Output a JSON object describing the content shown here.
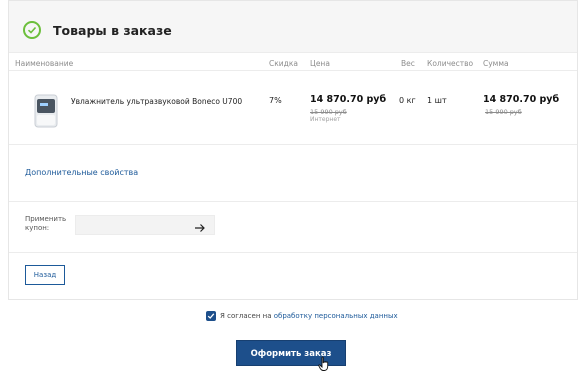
{
  "header": {
    "title": "Товары в заказе"
  },
  "columns": {
    "name": "Наименование",
    "discount": "Скидка",
    "price": "Цена",
    "weight": "Вес",
    "quantity": "Количество",
    "sum": "Сумма"
  },
  "item": {
    "name": "Увлажнитель ультразвуковой Boneco U700",
    "discount": "7%",
    "price": "14 870.70 руб",
    "old_price": "15 990 руб",
    "price_note": "Интернет",
    "weight": "0 кг",
    "quantity": "1 шт",
    "sum": "14 870.70 руб",
    "old_sum": "15 990 руб"
  },
  "props_link": "Дополнительные свойства",
  "coupon": {
    "label": "Применить купон:",
    "value": ""
  },
  "back_button": "Назад",
  "consent": {
    "prefix": "Я согласен на ",
    "link": "обработку персональных данных",
    "checked": true
  },
  "order_button": "Оформить заказ",
  "colors": {
    "accent": "#1d4f8b",
    "success": "#6cbf3c"
  }
}
